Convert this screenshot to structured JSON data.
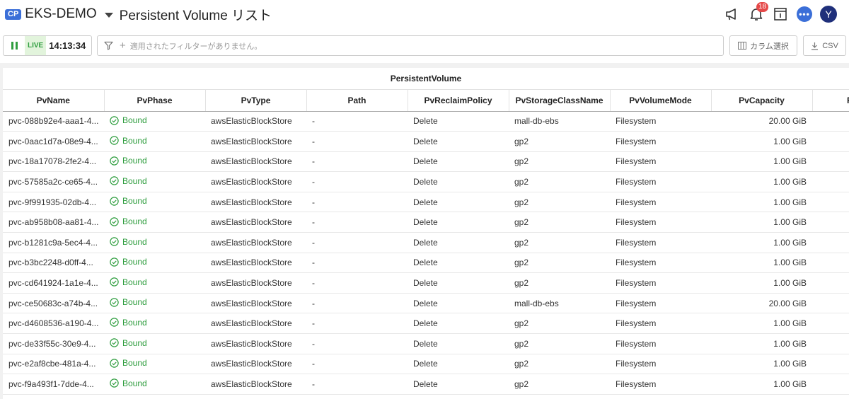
{
  "header": {
    "badge": "CP",
    "project": "EKS-DEMO",
    "title": "Persistent Volume リスト",
    "notification_count": "18",
    "avatar_letter": "Y",
    "chat_label": "•••"
  },
  "toolbar": {
    "live_label": "LIVE",
    "time": "14:13:34",
    "filter_placeholder": "適用されたフィルターがありません。",
    "column_select_label": "カラム選択",
    "csv_label": "CSV"
  },
  "table": {
    "group_header": "PersistentVolume",
    "columns": [
      "PvName",
      "PvPhase",
      "PvType",
      "Path",
      "PvReclaimPolicy",
      "PvStorageClassName",
      "PvVolumeMode",
      "PvCapacity",
      "P"
    ],
    "rows": [
      {
        "name": "pvc-088b92e4-aaa1-4...",
        "phase": "Bound",
        "type": "awsElasticBlockStore",
        "path": "-",
        "reclaim": "Delete",
        "storage_class": "mall-db-ebs",
        "mode": "Filesystem",
        "capacity": "20.00 GiB"
      },
      {
        "name": "pvc-0aac1d7a-08e9-4...",
        "phase": "Bound",
        "type": "awsElasticBlockStore",
        "path": "-",
        "reclaim": "Delete",
        "storage_class": "gp2",
        "mode": "Filesystem",
        "capacity": "1.00 GiB"
      },
      {
        "name": "pvc-18a17078-2fe2-4...",
        "phase": "Bound",
        "type": "awsElasticBlockStore",
        "path": "-",
        "reclaim": "Delete",
        "storage_class": "gp2",
        "mode": "Filesystem",
        "capacity": "1.00 GiB"
      },
      {
        "name": "pvc-57585a2c-ce65-4...",
        "phase": "Bound",
        "type": "awsElasticBlockStore",
        "path": "-",
        "reclaim": "Delete",
        "storage_class": "gp2",
        "mode": "Filesystem",
        "capacity": "1.00 GiB"
      },
      {
        "name": "pvc-9f991935-02db-4...",
        "phase": "Bound",
        "type": "awsElasticBlockStore",
        "path": "-",
        "reclaim": "Delete",
        "storage_class": "gp2",
        "mode": "Filesystem",
        "capacity": "1.00 GiB"
      },
      {
        "name": "pvc-ab958b08-aa81-4...",
        "phase": "Bound",
        "type": "awsElasticBlockStore",
        "path": "-",
        "reclaim": "Delete",
        "storage_class": "gp2",
        "mode": "Filesystem",
        "capacity": "1.00 GiB"
      },
      {
        "name": "pvc-b1281c9a-5ec4-4...",
        "phase": "Bound",
        "type": "awsElasticBlockStore",
        "path": "-",
        "reclaim": "Delete",
        "storage_class": "gp2",
        "mode": "Filesystem",
        "capacity": "1.00 GiB"
      },
      {
        "name": "pvc-b3bc2248-d0ff-4...",
        "phase": "Bound",
        "type": "awsElasticBlockStore",
        "path": "-",
        "reclaim": "Delete",
        "storage_class": "gp2",
        "mode": "Filesystem",
        "capacity": "1.00 GiB"
      },
      {
        "name": "pvc-cd641924-1a1e-4...",
        "phase": "Bound",
        "type": "awsElasticBlockStore",
        "path": "-",
        "reclaim": "Delete",
        "storage_class": "gp2",
        "mode": "Filesystem",
        "capacity": "1.00 GiB"
      },
      {
        "name": "pvc-ce50683c-a74b-4...",
        "phase": "Bound",
        "type": "awsElasticBlockStore",
        "path": "-",
        "reclaim": "Delete",
        "storage_class": "mall-db-ebs",
        "mode": "Filesystem",
        "capacity": "20.00 GiB"
      },
      {
        "name": "pvc-d4608536-a190-4...",
        "phase": "Bound",
        "type": "awsElasticBlockStore",
        "path": "-",
        "reclaim": "Delete",
        "storage_class": "gp2",
        "mode": "Filesystem",
        "capacity": "1.00 GiB"
      },
      {
        "name": "pvc-de33f55c-30e9-4...",
        "phase": "Bound",
        "type": "awsElasticBlockStore",
        "path": "-",
        "reclaim": "Delete",
        "storage_class": "gp2",
        "mode": "Filesystem",
        "capacity": "1.00 GiB"
      },
      {
        "name": "pvc-e2af8cbe-481a-4...",
        "phase": "Bound",
        "type": "awsElasticBlockStore",
        "path": "-",
        "reclaim": "Delete",
        "storage_class": "gp2",
        "mode": "Filesystem",
        "capacity": "1.00 GiB"
      },
      {
        "name": "pvc-f9a493f1-7dde-4...",
        "phase": "Bound",
        "type": "awsElasticBlockStore",
        "path": "-",
        "reclaim": "Delete",
        "storage_class": "gp2",
        "mode": "Filesystem",
        "capacity": "1.00 GiB"
      }
    ]
  },
  "icons": {
    "announcement": "megaphone-icon",
    "notifications": "bell-icon",
    "docs": "book-icon",
    "chat": "chat-icon",
    "pause": "pause-icon",
    "filter": "filter-icon",
    "columns": "columns-icon",
    "download": "download-icon",
    "status": "check-circle-icon"
  },
  "colors": {
    "accent": "#3b6fd8",
    "live_green": "#2e9d3e",
    "notification_red": "#e54848",
    "avatar": "#1f2f7a"
  }
}
